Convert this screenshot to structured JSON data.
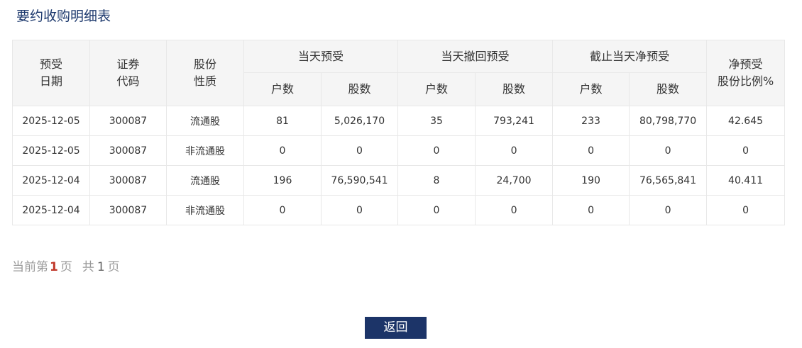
{
  "page": {
    "title": "要约收购明细表"
  },
  "table": {
    "headers": {
      "date": [
        "预受",
        "日期"
      ],
      "code": [
        "证券",
        "代码"
      ],
      "nature": [
        "股份",
        "性质"
      ],
      "today_accept": "当天预受",
      "today_withdraw": "当天撤回预受",
      "cumulative_net": "截止当天净预受",
      "net_ratio": [
        "净预受",
        "股份比例%"
      ],
      "households": "户数",
      "shares": "股数"
    },
    "rows": [
      [
        "2025-12-05",
        "300087",
        "流通股",
        "81",
        "5,026,170",
        "35",
        "793,241",
        "233",
        "80,798,770",
        "42.645"
      ],
      [
        "2025-12-05",
        "300087",
        "非流通股",
        "0",
        "0",
        "0",
        "0",
        "0",
        "0",
        "0"
      ],
      [
        "2025-12-04",
        "300087",
        "流通股",
        "196",
        "76,590,541",
        "8",
        "24,700",
        "190",
        "76,565,841",
        "40.411"
      ],
      [
        "2025-12-04",
        "300087",
        "非流通股",
        "0",
        "0",
        "0",
        "0",
        "0",
        "0",
        "0"
      ]
    ]
  },
  "pager": {
    "prefix": "当前第",
    "current": "1",
    "page_unit": "页",
    "total_prefix": "共",
    "total": "1",
    "total_unit": "页"
  },
  "actions": {
    "back_label": "返回"
  }
}
